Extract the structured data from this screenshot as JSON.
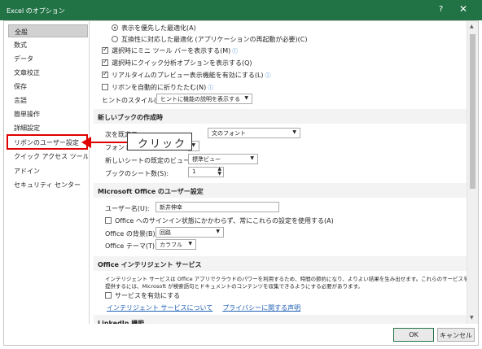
{
  "window": {
    "title": "Excel のオプション",
    "help_glyph": "?",
    "close_glyph": "✕",
    "accent_color": "#217346"
  },
  "sidebar": {
    "items": [
      {
        "label": "全般",
        "selected": true
      },
      {
        "label": "数式"
      },
      {
        "label": "データ"
      },
      {
        "label": "文章校正"
      },
      {
        "label": "保存"
      },
      {
        "label": "言語"
      },
      {
        "label": "簡単操作"
      },
      {
        "label": "詳細設定"
      },
      {
        "label": "リボンのユーザー設定",
        "highlighted": true
      },
      {
        "label": "クイック アクセス ツール バー"
      },
      {
        "label": "アドイン"
      },
      {
        "label": "セキュリティ センター"
      }
    ]
  },
  "ui_options": {
    "radio_display_optimize": "表示を優先した最適化(A)",
    "radio_compat_optimize": "互換性に対応した最適化 (アプリケーションの再起動が必要)(C)",
    "show_mini_toolbar": "選択時にミニ ツール バーを表示する(M)",
    "show_quick_analysis": "選択時にクイック分析オプションを表示する(Q)",
    "live_preview": "リアルタイムのプレビュー表示機能を有効にする(L)",
    "collapse_ribbon": "リボンを自動的に折りたたむ(N)",
    "screentip_label": "ヒントのスタイル(R):",
    "screentip_value": "ヒントに機能の説明を表示する",
    "info_icon": "ⓘ"
  },
  "new_workbook": {
    "header": "新しいブックの作成時",
    "font_label": "次を既定フ",
    "font_value": "文のフォント",
    "size_label": "フォント サ",
    "view_label": "新しいシートの既定のビュー(V):",
    "view_value": "標準ビュー",
    "sheets_label": "ブックのシート数(S):",
    "sheets_value": "1"
  },
  "user_settings": {
    "header": "Microsoft Office のユーザー設定",
    "username_label": "ユーザー名(U):",
    "username_value": "新井伸幸",
    "always_use": "Office へのサインイン状態にかかわらず、常にこれらの設定を使用する(A)",
    "background_label": "Office の背景(B):",
    "background_value": "回路",
    "theme_label": "Office テーマ(T):",
    "theme_value": "カラフル"
  },
  "intelligent_services": {
    "header": "Office インテリジェント サービス",
    "description_line1": "インテリジェント サービスは Office アプリでクラウドのパワーを利用するため、時間の節約になり、よりよい結果を生み出せます。これらのサービスを",
    "description_line2": "提供するには、Microsoft が検索語句とドキュメントのコンテンツを収集できるようにする必要があります。",
    "enable_services": "サービスを有効にする",
    "about_link": "インテリジェント サービスについて",
    "privacy_link": "プライバシーに関する声明"
  },
  "linkedin": {
    "header": "LinkedIn 機能"
  },
  "buttons": {
    "ok": "OK",
    "cancel": "キャンセル"
  },
  "callout": {
    "text": "クリック",
    "arrow_color": "#e00000"
  }
}
